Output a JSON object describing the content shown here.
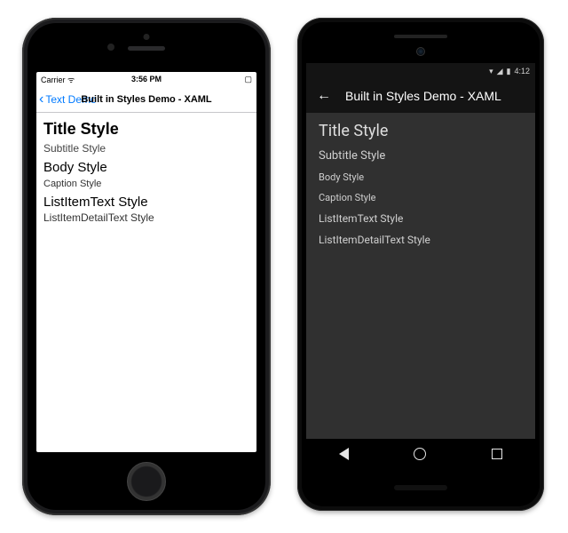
{
  "ios": {
    "status": {
      "carrier": "Carrier",
      "signal": "●●●●○",
      "wifi": "⧜",
      "time": "3:56 PM",
      "battery": "■"
    },
    "nav": {
      "back_label": "Text Demo",
      "title": "Built in Styles Demo - XAML"
    },
    "styles": {
      "title": "Title Style",
      "subtitle": "Subtitle Style",
      "body": "Body Style",
      "caption": "Caption Style",
      "listitem": "ListItemText Style",
      "listdetail": "ListItemDetailText Style"
    }
  },
  "android": {
    "status": {
      "icons": "▾ ◧ ▮",
      "time": "4:12"
    },
    "appbar": {
      "title": "Built in Styles Demo - XAML"
    },
    "styles": {
      "title": "Title Style",
      "subtitle": "Subtitle Style",
      "body": "Body Style",
      "caption": "Caption Style",
      "listitem": "ListItemText Style",
      "listdetail": "ListItemDetailText Style"
    }
  }
}
